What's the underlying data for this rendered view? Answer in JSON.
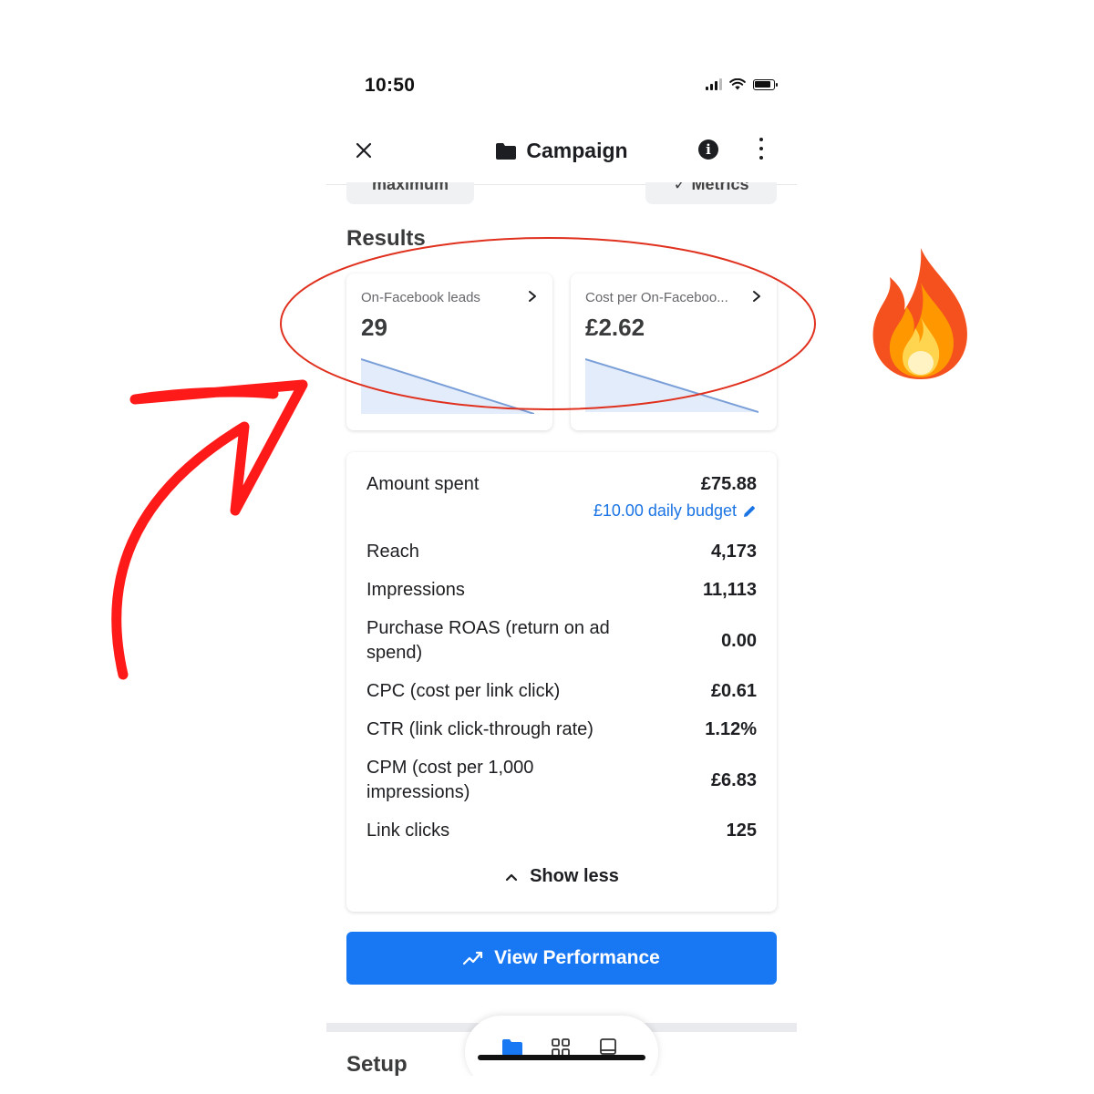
{
  "status_bar": {
    "time": "10:50"
  },
  "header": {
    "title": "Campaign",
    "close_icon": "close-icon",
    "folder_icon": "folder-icon",
    "info_icon": "info-icon",
    "more_icon": "more-vertical-icon"
  },
  "results": {
    "heading": "Results",
    "cards": [
      {
        "label": "On-Facebook leads",
        "value": "29"
      },
      {
        "label": "Cost per On-Faceboo...",
        "value": "£2.62"
      }
    ]
  },
  "summary": {
    "amount_spent": {
      "label": "Amount spent",
      "value": "£75.88"
    },
    "daily_budget": "£10.00 daily budget",
    "rows": [
      {
        "label": "Reach",
        "value": "4,173"
      },
      {
        "label": "Impressions",
        "value": "11,113"
      },
      {
        "label": "Purchase ROAS (return on ad spend)",
        "value": "0.00"
      },
      {
        "label": "CPC (cost per link click)",
        "value": "£0.61"
      },
      {
        "label": "CTR (link click-through rate)",
        "value": "1.12%"
      },
      {
        "label": "CPM (cost per 1,000 impressions)",
        "value": "£6.83"
      },
      {
        "label": "Link clicks",
        "value": "125"
      }
    ],
    "show_less": "Show less"
  },
  "view_performance": "View Performance",
  "setup_heading": "Setup",
  "colors": {
    "accent": "#1877f2",
    "link": "#1b74e4",
    "annotation_red": "#ff1a1a",
    "ellipse_red": "#e0301e"
  },
  "bottom_nav": {
    "icons": [
      "folder-icon",
      "grid-icon",
      "panel-icon"
    ],
    "active": "folder-icon"
  }
}
